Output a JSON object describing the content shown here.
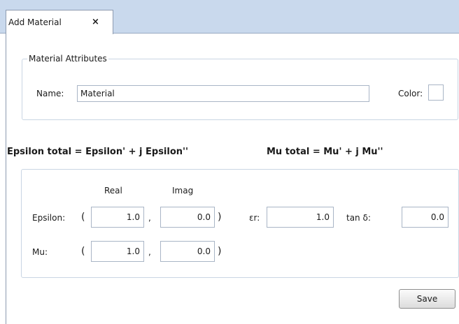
{
  "tab": {
    "label": "Add Material",
    "close": "×"
  },
  "attributes": {
    "legend": "Material Attributes",
    "name_label": "Name:",
    "name_value": "Material",
    "color_label": "Color:"
  },
  "formulas": {
    "epsilon": "Epsilon total = Epsilon' + j Epsilon''",
    "mu": "Mu total = Mu' + j Mu''"
  },
  "matrix": {
    "real_header": "Real",
    "imag_header": "Imag",
    "epsilon_label": "Epsilon:",
    "mu_label": "Mu:",
    "open_paren": "(",
    "close_paren": ")",
    "comma": ",",
    "epsilon_real": "1.0",
    "epsilon_imag": "0.0",
    "mu_real": "1.0",
    "mu_imag": "0.0",
    "er_label": "εr:",
    "er_value": "1.0",
    "tan_label": "tan δ:",
    "tan_value": "0.0"
  },
  "save_label": "Save"
}
